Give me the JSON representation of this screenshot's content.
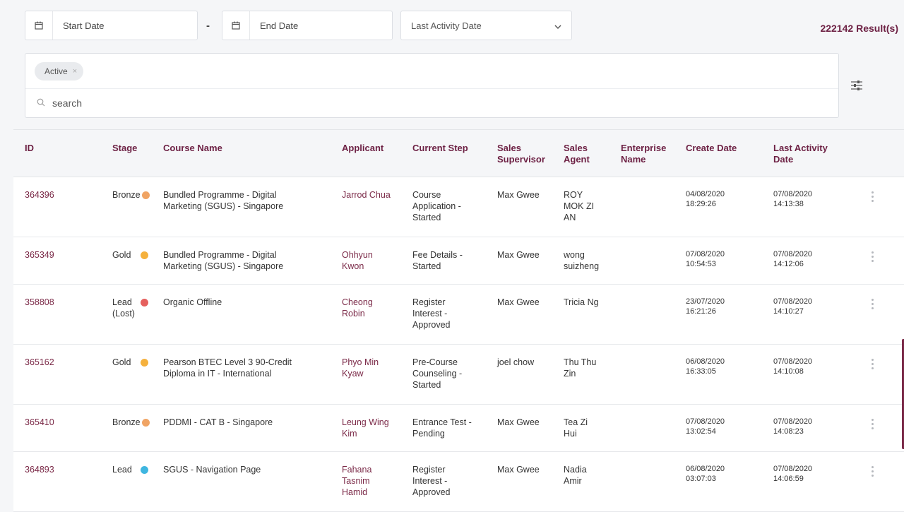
{
  "filters": {
    "start_date_placeholder": "Start Date",
    "end_date_placeholder": "End Date",
    "date_separator": "-",
    "date_type_selected": "Last Activity Date",
    "results_text": "222142 Result(s)",
    "active_chip": "Active",
    "search_placeholder": "search"
  },
  "colors": {
    "accent": "#6d2144",
    "bronze": "#f0a464",
    "gold": "#f5b13d",
    "lost": "#e5605e",
    "lead": "#3fb6e0"
  },
  "table": {
    "headers": {
      "id": "ID",
      "stage": "Stage",
      "course": "Course Name",
      "applicant": "Applicant",
      "step": "Current Step",
      "supervisor": [
        "Sales",
        "Supervisor"
      ],
      "agent": [
        "Sales",
        "Agent"
      ],
      "enterprise": [
        "Enterprise",
        "Name"
      ],
      "create": "Create Date",
      "activity": [
        "Last Activity",
        "Date"
      ]
    },
    "rows": [
      {
        "id": "364396",
        "stage": [
          "Bronze"
        ],
        "stage_color": "bronze",
        "course": [
          "Bundled Programme - Digital",
          "Marketing (SGUS) - Singapore"
        ],
        "applicant": [
          "Jarrod Chua"
        ],
        "step": [
          "Course",
          "Application -",
          "Started"
        ],
        "supervisor": "Max Gwee",
        "agent": [
          "ROY",
          "MOK ZI",
          "AN"
        ],
        "enterprise": "",
        "create": [
          "04/08/2020",
          "18:29:26"
        ],
        "activity": [
          "07/08/2020",
          "14:13:38"
        ]
      },
      {
        "id": "365349",
        "stage": [
          "Gold"
        ],
        "stage_color": "gold",
        "course": [
          "Bundled Programme - Digital",
          "Marketing (SGUS) - Singapore"
        ],
        "applicant": [
          "Ohhyun",
          "Kwon"
        ],
        "step": [
          "Fee Details -",
          "Started"
        ],
        "supervisor": "Max Gwee",
        "agent": [
          "wong",
          "suizheng"
        ],
        "enterprise": "",
        "create": [
          "07/08/2020",
          "10:54:53"
        ],
        "activity": [
          "07/08/2020",
          "14:12:06"
        ]
      },
      {
        "id": "358808",
        "stage": [
          "Lead",
          "(Lost)"
        ],
        "stage_color": "lost",
        "course": [
          "Organic Offline"
        ],
        "applicant": [
          "Cheong",
          "Robin"
        ],
        "step": [
          "Register",
          "Interest -",
          "Approved"
        ],
        "supervisor": "Max Gwee",
        "agent": [
          "Tricia Ng"
        ],
        "enterprise": "",
        "create": [
          "23/07/2020",
          "16:21:26"
        ],
        "activity": [
          "07/08/2020",
          "14:10:27"
        ]
      },
      {
        "id": "365162",
        "stage": [
          "Gold"
        ],
        "stage_color": "gold",
        "course": [
          "Pearson BTEC Level 3 90-Credit",
          "Diploma in IT - International"
        ],
        "applicant": [
          "Phyo Min",
          "Kyaw"
        ],
        "step": [
          "Pre-Course",
          "Counseling -",
          "Started"
        ],
        "supervisor": "joel chow",
        "agent": [
          "Thu Thu",
          "Zin"
        ],
        "enterprise": "",
        "create": [
          "06/08/2020",
          "16:33:05"
        ],
        "activity": [
          "07/08/2020",
          "14:10:08"
        ]
      },
      {
        "id": "365410",
        "stage": [
          "Bronze"
        ],
        "stage_color": "bronze",
        "course": [
          "PDDMI - CAT B - Singapore"
        ],
        "applicant": [
          "Leung Wing",
          "Kim"
        ],
        "step": [
          "Entrance Test -",
          "Pending"
        ],
        "supervisor": "Max Gwee",
        "agent": [
          "Tea Zi",
          "Hui"
        ],
        "enterprise": "",
        "create": [
          "07/08/2020",
          "13:02:54"
        ],
        "activity": [
          "07/08/2020",
          "14:08:23"
        ]
      },
      {
        "id": "364893",
        "stage": [
          "Lead"
        ],
        "stage_color": "lead",
        "course": [
          "SGUS - Navigation Page"
        ],
        "applicant": [
          "Fahana",
          "Tasnim",
          "Hamid"
        ],
        "step": [
          "Register",
          "Interest -",
          "Approved"
        ],
        "supervisor": "Max Gwee",
        "agent": [
          "Nadia",
          "Amir"
        ],
        "enterprise": "",
        "create": [
          "06/08/2020",
          "03:07:03"
        ],
        "activity": [
          "07/08/2020",
          "14:06:59"
        ]
      }
    ]
  }
}
